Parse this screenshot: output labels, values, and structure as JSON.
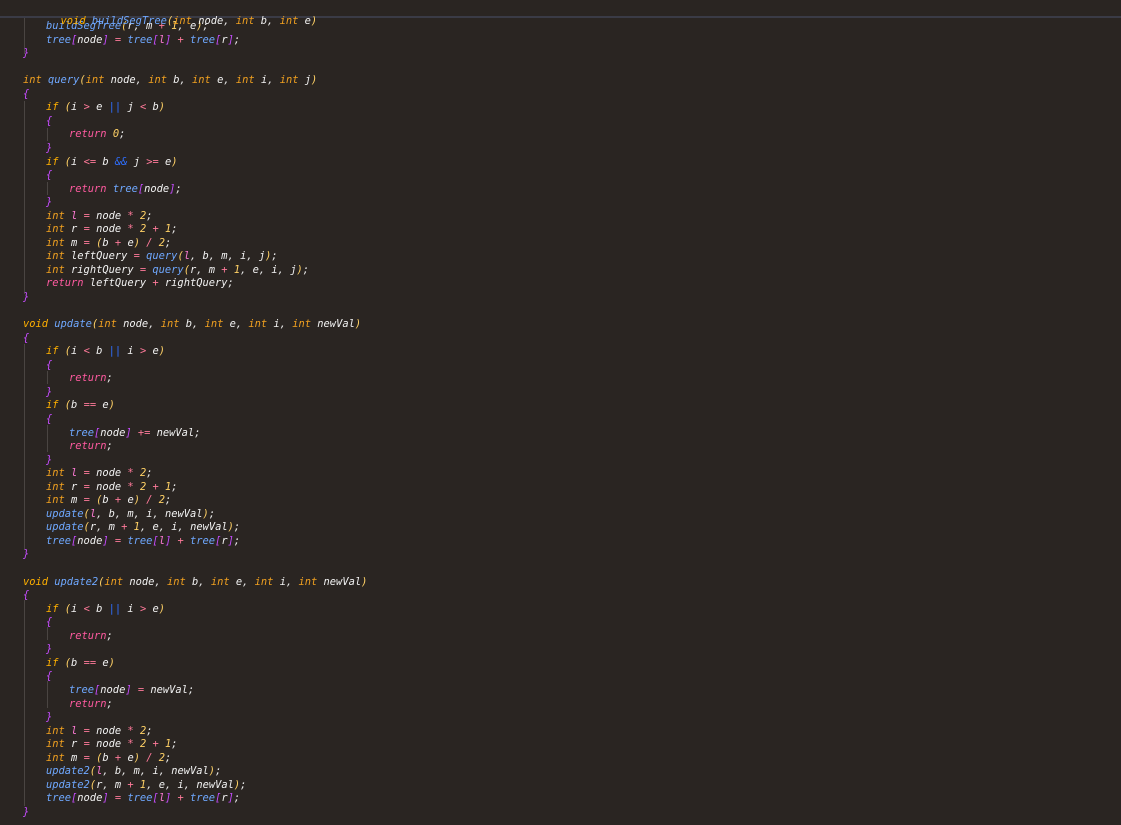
{
  "editor": {
    "sticky_header": "void buildSegTree(int node, int b, int e)",
    "lines": [
      {
        "y": 0,
        "indent": 1,
        "text": "buildSegTree(r, m + 1, e);"
      },
      {
        "y": 1,
        "indent": 1,
        "text": "tree[node] = tree[l] + tree[r];"
      },
      {
        "y": 2,
        "indent": 0,
        "text": "}"
      },
      {
        "y": 3,
        "indent": 0,
        "text": ""
      },
      {
        "y": 4,
        "indent": 0,
        "text": "int query(int node, int b, int e, int i, int j)"
      },
      {
        "y": 5,
        "indent": 0,
        "text": "{"
      },
      {
        "y": 6,
        "indent": 1,
        "text": "if (i > e || j < b)"
      },
      {
        "y": 7,
        "indent": 1,
        "text": "{"
      },
      {
        "y": 8,
        "indent": 2,
        "text": "return 0;"
      },
      {
        "y": 9,
        "indent": 1,
        "text": "}"
      },
      {
        "y": 10,
        "indent": 1,
        "text": "if (i <= b && j >= e)"
      },
      {
        "y": 11,
        "indent": 1,
        "text": "{"
      },
      {
        "y": 12,
        "indent": 2,
        "text": "return tree[node];"
      },
      {
        "y": 13,
        "indent": 1,
        "text": "}"
      },
      {
        "y": 14,
        "indent": 1,
        "text": "int l = node * 2;"
      },
      {
        "y": 15,
        "indent": 1,
        "text": "int r = node * 2 + 1;"
      },
      {
        "y": 16,
        "indent": 1,
        "text": "int m = (b + e) / 2;"
      },
      {
        "y": 17,
        "indent": 1,
        "text": "int leftQuery = query(l, b, m, i, j);"
      },
      {
        "y": 18,
        "indent": 1,
        "text": "int rightQuery = query(r, m + 1, e, i, j);"
      },
      {
        "y": 19,
        "indent": 1,
        "text": "return leftQuery + rightQuery;"
      },
      {
        "y": 20,
        "indent": 0,
        "text": "}"
      },
      {
        "y": 21,
        "indent": 0,
        "text": ""
      },
      {
        "y": 22,
        "indent": 0,
        "text": "void update(int node, int b, int e, int i, int newVal)"
      },
      {
        "y": 23,
        "indent": 0,
        "text": "{"
      },
      {
        "y": 24,
        "indent": 1,
        "text": "if (i < b || i > e)"
      },
      {
        "y": 25,
        "indent": 1,
        "text": "{"
      },
      {
        "y": 26,
        "indent": 2,
        "text": "return;"
      },
      {
        "y": 27,
        "indent": 1,
        "text": "}"
      },
      {
        "y": 28,
        "indent": 1,
        "text": "if (b == e)"
      },
      {
        "y": 29,
        "indent": 1,
        "text": "{"
      },
      {
        "y": 30,
        "indent": 2,
        "text": "tree[node] += newVal;"
      },
      {
        "y": 31,
        "indent": 2,
        "text": "return;"
      },
      {
        "y": 32,
        "indent": 1,
        "text": "}"
      },
      {
        "y": 33,
        "indent": 1,
        "text": "int l = node * 2;"
      },
      {
        "y": 34,
        "indent": 1,
        "text": "int r = node * 2 + 1;"
      },
      {
        "y": 35,
        "indent": 1,
        "text": "int m = (b + e) / 2;"
      },
      {
        "y": 36,
        "indent": 1,
        "text": "update(l, b, m, i, newVal);"
      },
      {
        "y": 37,
        "indent": 1,
        "text": "update(r, m + 1, e, i, newVal);"
      },
      {
        "y": 38,
        "indent": 1,
        "text": "tree[node] = tree[l] + tree[r];"
      },
      {
        "y": 39,
        "indent": 0,
        "text": "}"
      },
      {
        "y": 40,
        "indent": 0,
        "text": ""
      },
      {
        "y": 41,
        "indent": 0,
        "text": "void update2(int node, int b, int e, int i, int newVal)"
      },
      {
        "y": 42,
        "indent": 0,
        "text": "{"
      },
      {
        "y": 43,
        "indent": 1,
        "text": "if (i < b || i > e)"
      },
      {
        "y": 44,
        "indent": 1,
        "text": "{"
      },
      {
        "y": 45,
        "indent": 2,
        "text": "return;"
      },
      {
        "y": 46,
        "indent": 1,
        "text": "}"
      },
      {
        "y": 47,
        "indent": 1,
        "text": "if (b == e)"
      },
      {
        "y": 48,
        "indent": 1,
        "text": "{"
      },
      {
        "y": 49,
        "indent": 2,
        "text": "tree[node] = newVal;"
      },
      {
        "y": 50,
        "indent": 2,
        "text": "return;"
      },
      {
        "y": 51,
        "indent": 1,
        "text": "}"
      },
      {
        "y": 52,
        "indent": 1,
        "text": "int l = node * 2;"
      },
      {
        "y": 53,
        "indent": 1,
        "text": "int r = node * 2 + 1;"
      },
      {
        "y": 54,
        "indent": 1,
        "text": "int m = (b + e) / 2;"
      },
      {
        "y": 55,
        "indent": 1,
        "text": "update2(l, b, m, i, newVal);"
      },
      {
        "y": 56,
        "indent": 1,
        "text": "update2(r, m + 1, e, i, newVal);"
      },
      {
        "y": 57,
        "indent": 1,
        "text": "tree[node] = tree[l] + tree[r];"
      },
      {
        "y": 58,
        "indent": 0,
        "text": "}"
      }
    ]
  }
}
